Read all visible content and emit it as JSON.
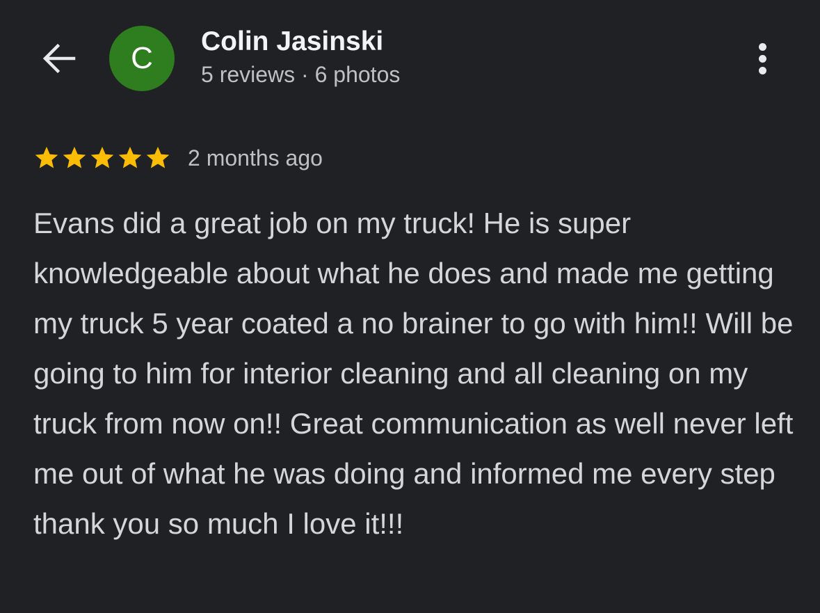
{
  "header": {
    "back_icon": "arrow-back-icon",
    "avatar_letter": "C",
    "avatar_color": "#2e7d1f",
    "user_name": "Colin Jasinski",
    "user_meta": "5 reviews · 6 photos",
    "more_icon": "more-vert-icon"
  },
  "review": {
    "rating": 5,
    "max_rating": 5,
    "star_color": "#fbbc04",
    "time_ago": "2 months ago",
    "text": "Evans did a great job on my truck! He is super knowledgeable about what he does and made me getting my truck 5 year coated a no brainer to go with him!! Will be going to him for interior cleaning and all cleaning on my truck from now on!! Great communication as well never left me out of what he was doing and informed me every step thank you so much I love it!!!"
  }
}
